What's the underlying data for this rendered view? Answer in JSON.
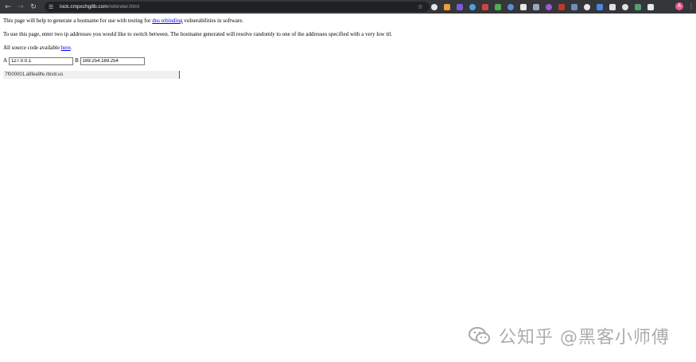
{
  "browser": {
    "url_host": "lock.cmpxchg8b.com",
    "url_path": "/rebinder.html",
    "extension_colors": [
      "#e6e6e6",
      "#f29b38",
      "#7b5cd6",
      "#4aa3df",
      "#d0453c",
      "#4caf50",
      "#5b8bd9",
      "#e8e8e8",
      "#9ab",
      "#9b59d6",
      "#c0392b",
      "#6c8ebf",
      "#e8e8e8",
      "#4a86e8",
      "#e0e0e0",
      "#e0e0e0",
      "#4fa36b",
      "#e8e8e8"
    ],
    "profile_initial": "A"
  },
  "page": {
    "intro_before": "This page will help to generate a hostname for use with testing for ",
    "intro_link": "dns rebinding",
    "intro_after": " vulnerabilities in software.",
    "usage": "To use this page, enter two ip addresses you would like to switch between. The hostname generated will resolve randomly to one of the addresses specified with a very low ttl.",
    "source_before": "All source code available ",
    "source_link": "here",
    "source_after": ".",
    "label_a": "A",
    "value_a": "127.0.0.1",
    "label_b": "B",
    "value_b": "169.254.169.254",
    "hostname": "7f000001.a9fea9fe.rbndr.us"
  },
  "watermark": {
    "text": "公知乎 @黑客小师傅"
  }
}
